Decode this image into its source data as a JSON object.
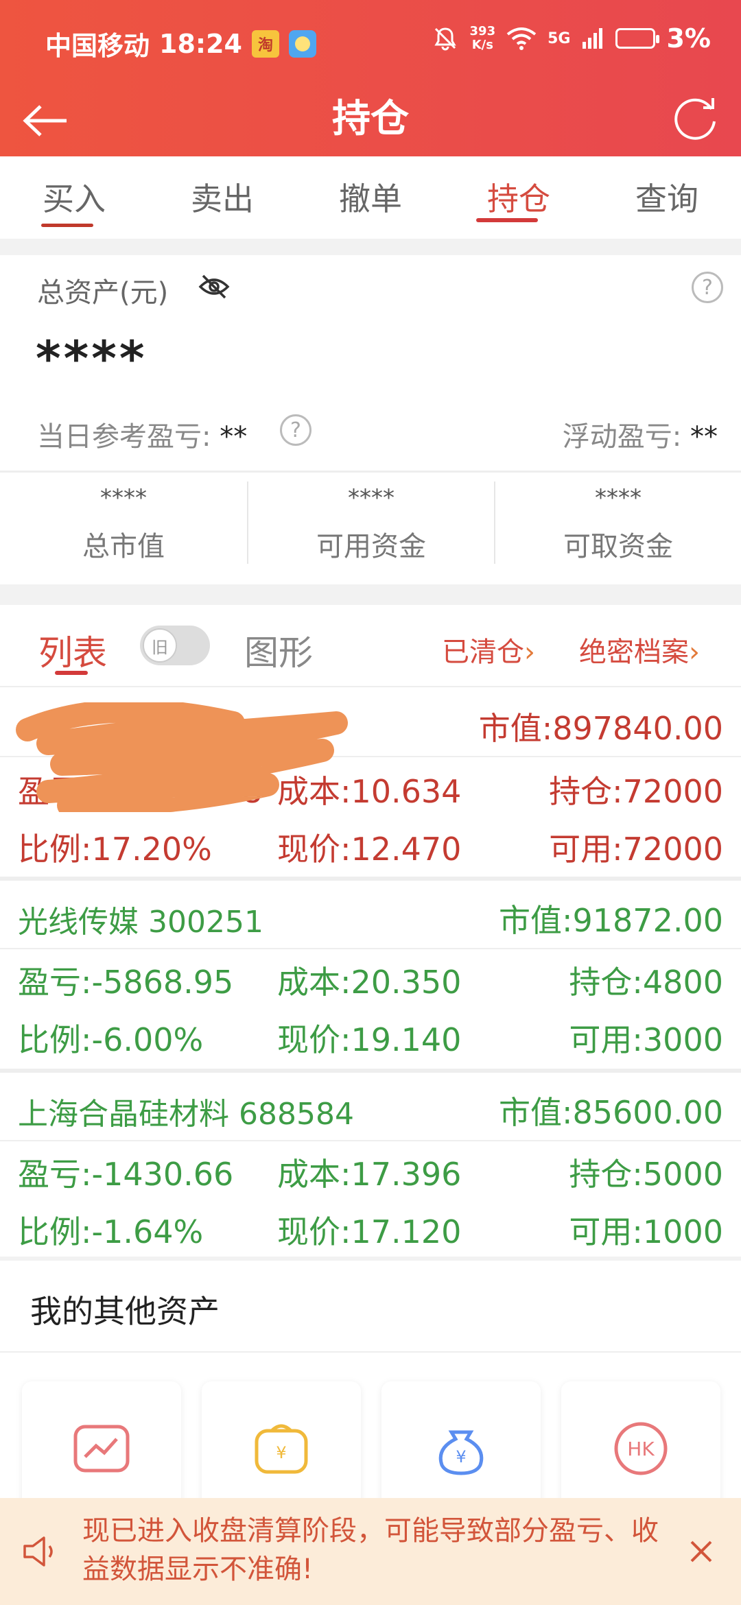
{
  "status_bar": {
    "carrier": "中国移动",
    "time": "18:24",
    "app_badge": "淘",
    "net_speed_value": "393",
    "net_speed_unit": "K/s",
    "network": "5G",
    "battery": "3%"
  },
  "nav": {
    "title": "持仓",
    "back_icon": "arrow-left-icon",
    "refresh_icon": "refresh-icon"
  },
  "tabs": [
    {
      "label": "买入",
      "active": false
    },
    {
      "label": "卖出",
      "active": false
    },
    {
      "label": "撤单",
      "active": false
    },
    {
      "label": "持仓",
      "active": true
    },
    {
      "label": "查询",
      "active": false
    }
  ],
  "assets": {
    "label": "总资产(元)",
    "total": "****",
    "help": "?",
    "daily_pl_label": "当日参考盈亏: ",
    "daily_pl_value": "**",
    "float_pl_label": "浮动盈亏: ",
    "float_pl_value": "**",
    "metrics": [
      {
        "value": "****",
        "label": "总市值"
      },
      {
        "value": "****",
        "label": "可用资金"
      },
      {
        "value": "****",
        "label": "可取资金"
      }
    ]
  },
  "positions_header": {
    "list_label": "列表",
    "toggle_label": "旧",
    "chart_label": "图形",
    "cleared_link": "已清仓",
    "archive_link": "绝密档案"
  },
  "stocks": [
    {
      "name": "",
      "market_value": "市值:897840.00",
      "pl": "盈亏:131756.68",
      "cost": "成本:10.634",
      "holding": "持仓:72000",
      "ratio": "比例:17.20%",
      "price": "现价:12.470",
      "available": "可用:72000",
      "trend": "up"
    },
    {
      "name": "光线传媒 300251",
      "market_value": "市值:91872.00",
      "pl": "盈亏:-5868.95",
      "cost": "成本:20.350",
      "holding": "持仓:4800",
      "ratio": "比例:-6.00%",
      "price": "现价:19.140",
      "available": "可用:3000",
      "trend": "down"
    },
    {
      "name": "上海合晶硅材料 688584",
      "market_value": "市值:85600.00",
      "pl": "盈亏:-1430.66",
      "cost": "成本:17.396",
      "holding": "持仓:5000",
      "ratio": "比例:-1.64%",
      "price": "现价:17.120",
      "available": "可用:1000",
      "trend": "down"
    }
  ],
  "other_assets": {
    "title": "我的其他资产",
    "tiles": [
      {
        "icon": "trend-chart-icon",
        "color": "#e8787a"
      },
      {
        "icon": "coin-wallet-icon",
        "color": "#f0b93a"
      },
      {
        "icon": "money-bag-icon",
        "color": "#5b8ef0"
      },
      {
        "icon": "hk-icon",
        "color": "#e8787a"
      }
    ]
  },
  "notice": {
    "text": "现已进入收盘清算阶段，可能导致部分盈亏、收益数据显示不准确!",
    "close_icon": "close-icon"
  },
  "colors": {
    "brand_red": "#e8484f",
    "up": "#c43b31",
    "down": "#3d9c45"
  }
}
